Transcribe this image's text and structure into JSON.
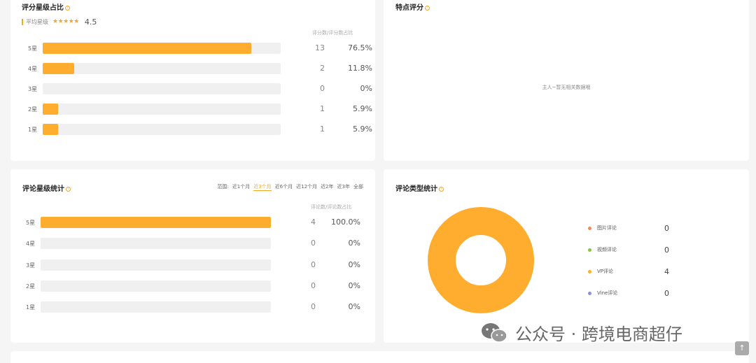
{
  "rating_share": {
    "title": "评分星级占比",
    "avg_label": "平均星级",
    "avg_stars": "★★★★★",
    "avg_value": "4.5",
    "column_header": "评分数/评分数占比",
    "rows": [
      {
        "label": "5星",
        "count": "13",
        "percent": "76.5%",
        "fill": 0.875
      },
      {
        "label": "4星",
        "count": "2",
        "percent": "11.8%",
        "fill": 0.133
      },
      {
        "label": "3星",
        "count": "0",
        "percent": "0%",
        "fill": 0
      },
      {
        "label": "2星",
        "count": "1",
        "percent": "5.9%",
        "fill": 0.066
      },
      {
        "label": "1星",
        "count": "1",
        "percent": "5.9%",
        "fill": 0.066
      }
    ]
  },
  "feature_rating": {
    "title": "特点评分",
    "empty_text": "主人~暂无相关数据哦"
  },
  "review_rating_stats": {
    "title": "评论星级统计",
    "range_label": "范围:",
    "range_options": [
      "近1个月",
      "近3个月",
      "近6个月",
      "近12个月",
      "近2年",
      "近3年",
      "全部"
    ],
    "active_range": 1,
    "column_header": "评论数/评论数占比",
    "rows": [
      {
        "label": "5星",
        "count": "4",
        "percent": "100.0%",
        "fill": 1.0
      },
      {
        "label": "4星",
        "count": "0",
        "percent": "0%",
        "fill": 0
      },
      {
        "label": "3星",
        "count": "0",
        "percent": "0%",
        "fill": 0
      },
      {
        "label": "2星",
        "count": "0",
        "percent": "0%",
        "fill": 0
      },
      {
        "label": "1星",
        "count": "0",
        "percent": "0%",
        "fill": 0
      }
    ]
  },
  "review_type_stats": {
    "title": "评论类型统计",
    "legend": [
      {
        "name": "图片评论",
        "value": "0",
        "color": "#f08a5d"
      },
      {
        "name": "视频评论",
        "value": "0",
        "color": "#8bc34a"
      },
      {
        "name": "VP评论",
        "value": "4",
        "color": "#ffad2e"
      },
      {
        "name": "Vine评论",
        "value": "0",
        "color": "#8c8fd6"
      }
    ]
  },
  "watermark": {
    "text": "公众号 · 跨境电商超仔"
  },
  "scroll_top_icon": "arrow-up-icon"
}
